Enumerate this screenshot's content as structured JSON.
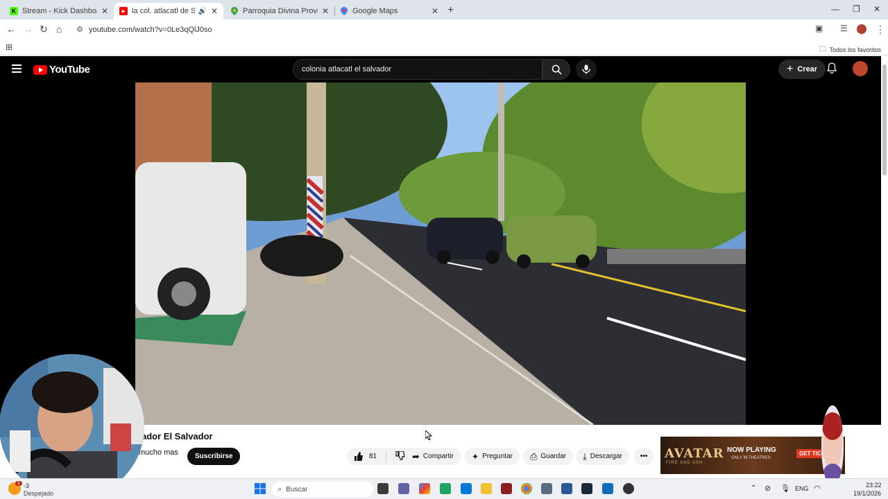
{
  "browser": {
    "tabs": [
      {
        "title": "Stream - Kick Dashboard",
        "fav_color": "#53fc18",
        "fav_char": "K"
      },
      {
        "title": "la col. atlacatl de San Salva",
        "fav_color": "#ff0000",
        "fav_char": "▶"
      },
      {
        "title": "Parroquia Divina Providencia -",
        "fav_color": "#34a853",
        "fav_char": ""
      },
      {
        "title": "Google Maps",
        "fav_color": "#4285f4",
        "fav_char": ""
      }
    ],
    "url": "youtube.com/watch?v=0Le3qQlJ0so",
    "bookmarks_label": "Todos los favoritos"
  },
  "youtube": {
    "logo_text": "YouTube",
    "search_value": "colonia atlacatl el salvador",
    "create_label": "Crear",
    "video": {
      "title_visible": "ador El Salvador",
      "subtitle_visible": "mucho mas",
      "subscribe_label": "Suscribirse",
      "likes": "81",
      "share_label": "Compartir",
      "ask_label": "Preguntar",
      "save_label": "Guardar",
      "download_label": "Descargar"
    },
    "ad": {
      "brand": "AVATAR",
      "tagline": "NOW PLAYING",
      "sub": "ONLY IN THEATRES",
      "cta": "GET TICK",
      "line": "FIRE AND ASH"
    }
  },
  "taskbar": {
    "search_placeholder": "Buscar",
    "weather_temp": "-3",
    "weather_text": "Despejado",
    "lang": "ENG",
    "time": "23:22",
    "date": "19/1/2026",
    "notification_count": "1"
  },
  "colors": {
    "accent_red": "#ff0000",
    "dark_bg": "#000000",
    "tab_bar": "#dfe3ea"
  }
}
